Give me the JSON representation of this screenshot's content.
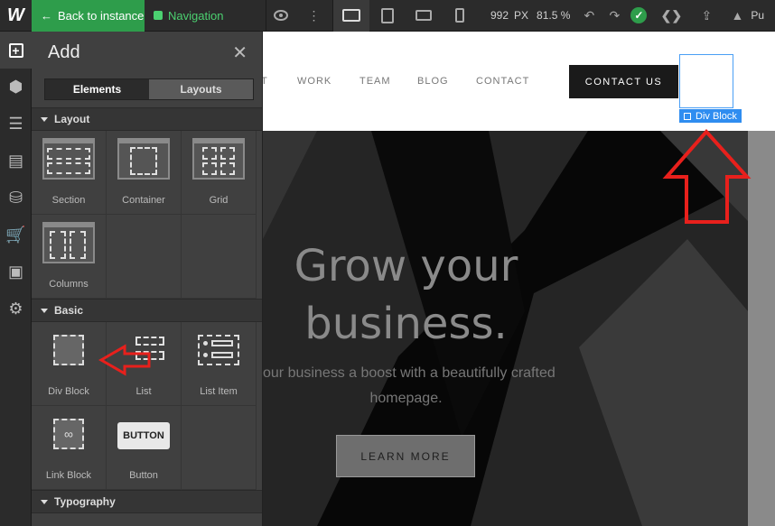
{
  "topbar": {
    "back_label": "Back to instance",
    "nav_label": "Navigation",
    "width_value": "992",
    "width_unit": "PX",
    "zoom": "81.5 %",
    "publish_partial": "Pu"
  },
  "panel": {
    "title": "Add",
    "tabs": [
      "Elements",
      "Layouts"
    ],
    "sections": {
      "layout": "Layout",
      "basic": "Basic",
      "typography": "Typography"
    },
    "layout_items": [
      "Section",
      "Container",
      "Grid",
      "Columns"
    ],
    "basic_items": [
      "Div Block",
      "List",
      "List Item",
      "Link Block",
      "Button"
    ],
    "button_icon_label": "BUTTON"
  },
  "site": {
    "nav_links": [
      "WORK",
      "TEAM",
      "BLOG",
      "CONTACT"
    ],
    "nav_partial": "T",
    "contact_button": "CONTACT US",
    "selected_tag": "Div Block",
    "hero_title_line1": "Grow your",
    "hero_title_line2": "business.",
    "hero_sub_line1": "our business a boost with a beautifully crafted",
    "hero_sub_line2": "homepage.",
    "learn_more": "LEARN MORE"
  },
  "colors": {
    "accent_green": "#2e9d4b",
    "selection_blue": "#2f8df0",
    "annotation_red": "#e8201c"
  }
}
